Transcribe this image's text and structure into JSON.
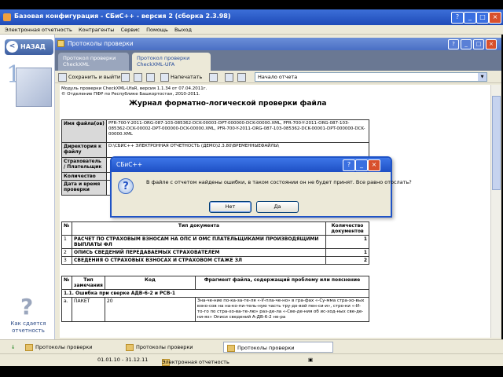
{
  "window": {
    "title": "Базовая конфигурация - СБиС++ - версия 2 (сборка 2.3.98)"
  },
  "menu": [
    "Электронная отчетность",
    "Контрагенты",
    "Сервис",
    "Помощь",
    "Выход"
  ],
  "left_panel": {
    "back_label": "НАЗАД",
    "step_number": "1",
    "help_question": "?",
    "help_label": "Как сдается отчетность"
  },
  "inner": {
    "title": "Протоколы проверки",
    "tabs": [
      {
        "line1": "Протокол проверки",
        "line2": "CheckXML"
      },
      {
        "line1": "Протокол проверки",
        "line2": "CheckXML-UFA"
      }
    ]
  },
  "toolbar": {
    "save_exit": "Сохранить и выйти",
    "print": "Напечатать",
    "section": "Начало отчета"
  },
  "doc": {
    "module_line": "Модуль проверки CheckXML-UfaR, версия 1.1.34 от 07.04.2011г.",
    "dept_line": "© Отделение ПФР по Республике Башкортостан, 2010-2011.",
    "heading": "Журнал форматно-логической проверки файла",
    "info": [
      {
        "k": "Имя файла(ов)",
        "v": "PFR-700-Y-2011-ORG-087-103-085362-DCK-00003-DPT-000000-DCK-00000.XML, PFR-700-Y-2011-ORG-087-103-085362-DCK-00002-DPT-000000-DCK-00000.XML, PFR-700-Y-2011-ORG-087-103-085362-DCK-00001-DPT-000000-DCK-00000.XML"
      },
      {
        "k": "Директория к файлу",
        "v": "D:\\СБИС++ ЭЛЕКТРОННАЯ ОТЧЕТНОСТЬ (ДЕМО)2.3.80\\ВРЕМЕННЫЕФАЙЛЫ\\"
      },
      {
        "k": "Страхователь / Плательщик",
        "v": ""
      },
      {
        "k": "Количество",
        "v": ""
      },
      {
        "k": "Дата и время проверки",
        "v": ""
      }
    ],
    "t1_headers": [
      "№",
      "Тип документа",
      "Количество документов"
    ],
    "t1_rows": [
      {
        "n": "1",
        "type": "РАСЧЕТ ПО СТРАХОВЫМ ВЗНОСАМ НА ОПС И ОМС ПЛАТЕЛЬЩИКАМИ ПРОИЗВОДЯЩИМИ ВЫПЛАТЫ ФЛ",
        "count": "1"
      },
      {
        "n": "2",
        "type": "ОПИСЬ СВЕДЕНИЙ ПЕРЕДАВАЕМЫХ СТРАХОВАТЕЛЕМ",
        "count": "1"
      },
      {
        "n": "3",
        "type": "СВЕДЕНИЯ О СТРАХОВЫХ ВЗНОСАХ И СТРАХОВОМ СТАЖЕ ЗЛ",
        "count": "2"
      }
    ],
    "t2_headers": [
      "№",
      "Тип замечания",
      "Код",
      "Фрагмент файла, содержащий проблему или пояснение"
    ],
    "t2_section": "1.1. Ошибка при сверке АДВ-6-2 и РСВ-1",
    "t2_row": {
      "n": "a.",
      "type": "ПАКЕТ",
      "code": "20",
      "fragment": "Зна-че-ние по-ка-за-те-ля «-У-пла-че-но» в гра-фах «-Су-мма стра-хо-вых взно-сов на на-ко-пи-тель-ную часть тру-до-вой пен-си-и», стро-ки «-И-то-го по стра-хо-ва-те-лю» раз-де-ла «-Све-де-ния об ис-ход-ных све-де-ни-ях» Описи сведений А-ДВ-6-2 не-ра"
    }
  },
  "dialog": {
    "title": "СБиС++",
    "message": "В файле с отчетом найдены ошибки, в таком состоянии он не будет принят. Все равно отослать?",
    "no": "Нет",
    "yes": "Да"
  },
  "bottom_tabs": [
    "Протоколы проверки",
    "Протоколы проверки",
    "Протоколы проверки"
  ],
  "status": {
    "period": "01.01.10 - 31.12.11",
    "section": "Электронная отчетность"
  }
}
